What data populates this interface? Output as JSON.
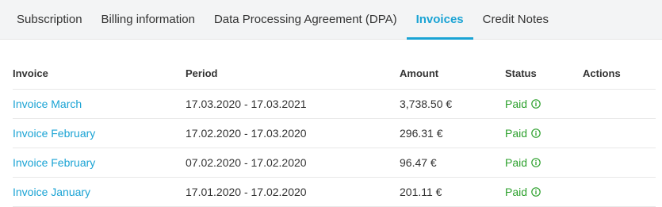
{
  "tabs": [
    {
      "label": "Subscription",
      "active": false
    },
    {
      "label": "Billing information",
      "active": false
    },
    {
      "label": "Data Processing Agreement (DPA)",
      "active": false
    },
    {
      "label": "Invoices",
      "active": true
    },
    {
      "label": "Credit Notes",
      "active": false
    }
  ],
  "table": {
    "headers": {
      "invoice": "Invoice",
      "period": "Period",
      "amount": "Amount",
      "status": "Status",
      "actions": "Actions"
    },
    "rows": [
      {
        "invoice": "Invoice March",
        "period": "17.03.2020 - 17.03.2021",
        "amount": "3,738.50 €",
        "status": "Paid"
      },
      {
        "invoice": "Invoice February",
        "period": "17.02.2020 - 17.03.2020",
        "amount": "296.31 €",
        "status": "Paid"
      },
      {
        "invoice": "Invoice February",
        "period": "07.02.2020 - 17.02.2020",
        "amount": "96.47 €",
        "status": "Paid"
      },
      {
        "invoice": "Invoice January",
        "period": "17.01.2020 - 17.02.2020",
        "amount": "201.11 €",
        "status": "Paid"
      }
    ]
  },
  "colors": {
    "accent": "#1aa3d4",
    "paid": "#2ca02c"
  },
  "icons": {
    "status_info": "info-circle-icon"
  }
}
